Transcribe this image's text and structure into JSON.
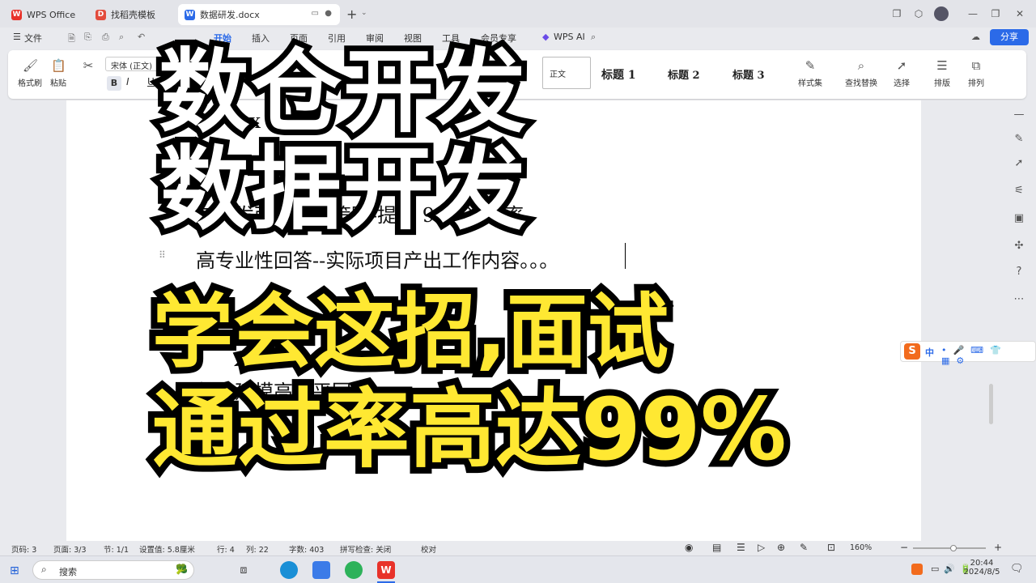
{
  "titlebar": {
    "tabs": [
      {
        "label": "WPS Office",
        "icon": "wps-logo-icon"
      },
      {
        "label": "找稻壳模板",
        "icon": "docer-icon"
      },
      {
        "label": "数据研发.docx",
        "icon": "word-doc-icon"
      }
    ],
    "new_tab": "+"
  },
  "menubar": {
    "file": "文件",
    "items": [
      "开始",
      "插入",
      "页面",
      "引用",
      "审阅",
      "视图",
      "工具",
      "会员专享"
    ],
    "wps_ai": "WPS AI",
    "share": "分享"
  },
  "ribbon": {
    "format_painter": "格式刷",
    "paste": "粘贴",
    "font_name": "宋体 (正文)",
    "bold": "B",
    "italic": "I",
    "underline": "U",
    "styles": [
      "正文",
      "标题 1",
      "标题 2",
      "标题 3"
    ],
    "style_set": "样式集",
    "find_replace": "查找替换",
    "select": "选择",
    "layout": "排版",
    "arrange": "排列"
  },
  "document": {
    "line1_partial": "X",
    "line3_partial": "包开发面试回答策略-提升 99%通过率",
    "line4": "高专业性回答--实际项目产出工作内容。。。",
    "line6_partial": "数仓建模高水平回答"
  },
  "overlay": {
    "title_line1": "数仓开发",
    "title_line2": "数据开发",
    "yellow_line1": "学会这招,面试",
    "yellow_line2": "通过率高达99%"
  },
  "ime": {
    "label": "中"
  },
  "statusbar": {
    "page_code": "页码: 3",
    "page": "页面: 3/3",
    "section": "节: 1/1",
    "setting": "设置值: 5.8厘米",
    "row": "行: 4",
    "col": "列: 22",
    "words": "字数: 403",
    "spell": "拼写检查: 关闭",
    "proof": "校对",
    "zoom": "160%"
  },
  "taskbar": {
    "search": "搜索",
    "time": "20:44",
    "date": "2024/8/5"
  }
}
